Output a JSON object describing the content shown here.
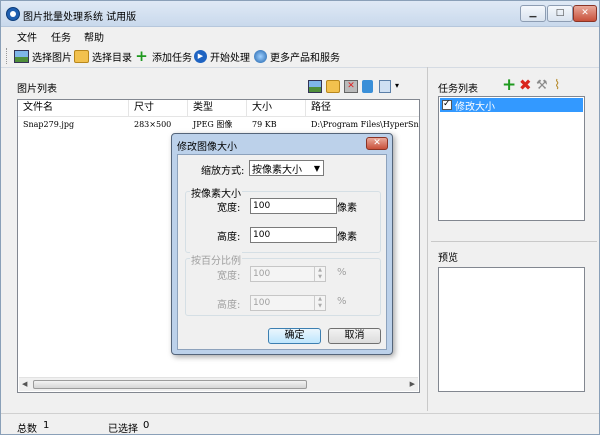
{
  "window": {
    "title": "图片批量处理系统 试用版",
    "min_label": "▁",
    "max_label": "□",
    "close_label": "✕"
  },
  "menu": [
    "文件",
    "任务",
    "帮助"
  ],
  "toolbar": {
    "select_images": "选择图片",
    "select_dir": "选择目录",
    "add_task": "添加任务",
    "start": "开始处理",
    "more": "更多产品和服务"
  },
  "image_list": {
    "title": "图片列表",
    "columns": [
      "文件名",
      "尺寸",
      "类型",
      "大小",
      "路径"
    ],
    "rows": [
      {
        "name": "Snap279.jpg",
        "dims": "283×500",
        "type": "JPEG 图像",
        "size": "79 KB",
        "path": "D:\\Program Files\\HyperSn"
      }
    ]
  },
  "task_list": {
    "title": "任务列表",
    "items": [
      {
        "label": "修改大小",
        "checked": true
      }
    ]
  },
  "preview": {
    "title": "预览"
  },
  "status": {
    "total_label": "总数",
    "total_value": "1",
    "selected_label": "已选择",
    "selected_value": "0"
  },
  "dialog": {
    "title": "修改图像大小",
    "close_label": "✕",
    "mode_label": "缩放方式:",
    "mode_value": "按像素大小",
    "pixel_group": "按像素大小",
    "width_label": "宽度:",
    "width_value": "100",
    "height_label": "高度:",
    "height_value": "100",
    "unit_px": "像素",
    "percent_group": "按百分比例",
    "pct_width_label": "宽度:",
    "pct_width_value": "100",
    "pct_height_label": "高度:",
    "pct_height_value": "100",
    "unit_pct": "%",
    "ok": "确定",
    "cancel": "取消"
  },
  "colors": {
    "selection": "#3399ff",
    "dialog_frame": "#bcd1ea"
  }
}
